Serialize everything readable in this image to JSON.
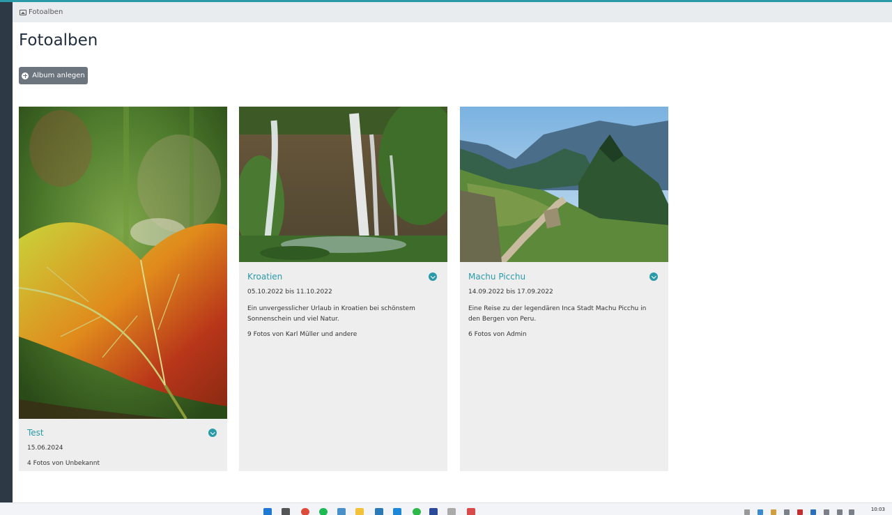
{
  "breadcrumb": {
    "icon": "photo-album-icon",
    "label": "Fotoalben"
  },
  "page": {
    "title": "Fotoalben"
  },
  "toolbar": {
    "add_album_label": "Album anlegen",
    "add_icon": "plus-circle-icon"
  },
  "albums": [
    {
      "title": "Test",
      "date": "15.06.2024",
      "description": "",
      "photo_count_text": "4 Fotos von Unbekannt",
      "image": "autumn-leaf-photo"
    },
    {
      "title": "Kroatien",
      "date": "05.10.2022 bis 11.10.2022",
      "description": "Ein unvergesslicher Urlaub in Kroatien bei schönstem Sonnenschein und viel Natur.",
      "photo_count_text": "9 Fotos von Karl Müller und andere",
      "image": "waterfall-photo"
    },
    {
      "title": "Machu Picchu",
      "date": "14.09.2022 bis 17.09.2022",
      "description": "Eine Reise zu der legendären Inca Stadt Machu Picchu in den Bergen von Peru.",
      "photo_count_text": "6 Fotos von Admin",
      "image": "machu-picchu-photo"
    }
  ],
  "taskbar": {
    "time": "10:03"
  },
  "colors": {
    "accent": "#2a9aa8",
    "sidebar": "#2d3a46",
    "card_bg": "#eeeeee",
    "button": "#6c757d"
  }
}
